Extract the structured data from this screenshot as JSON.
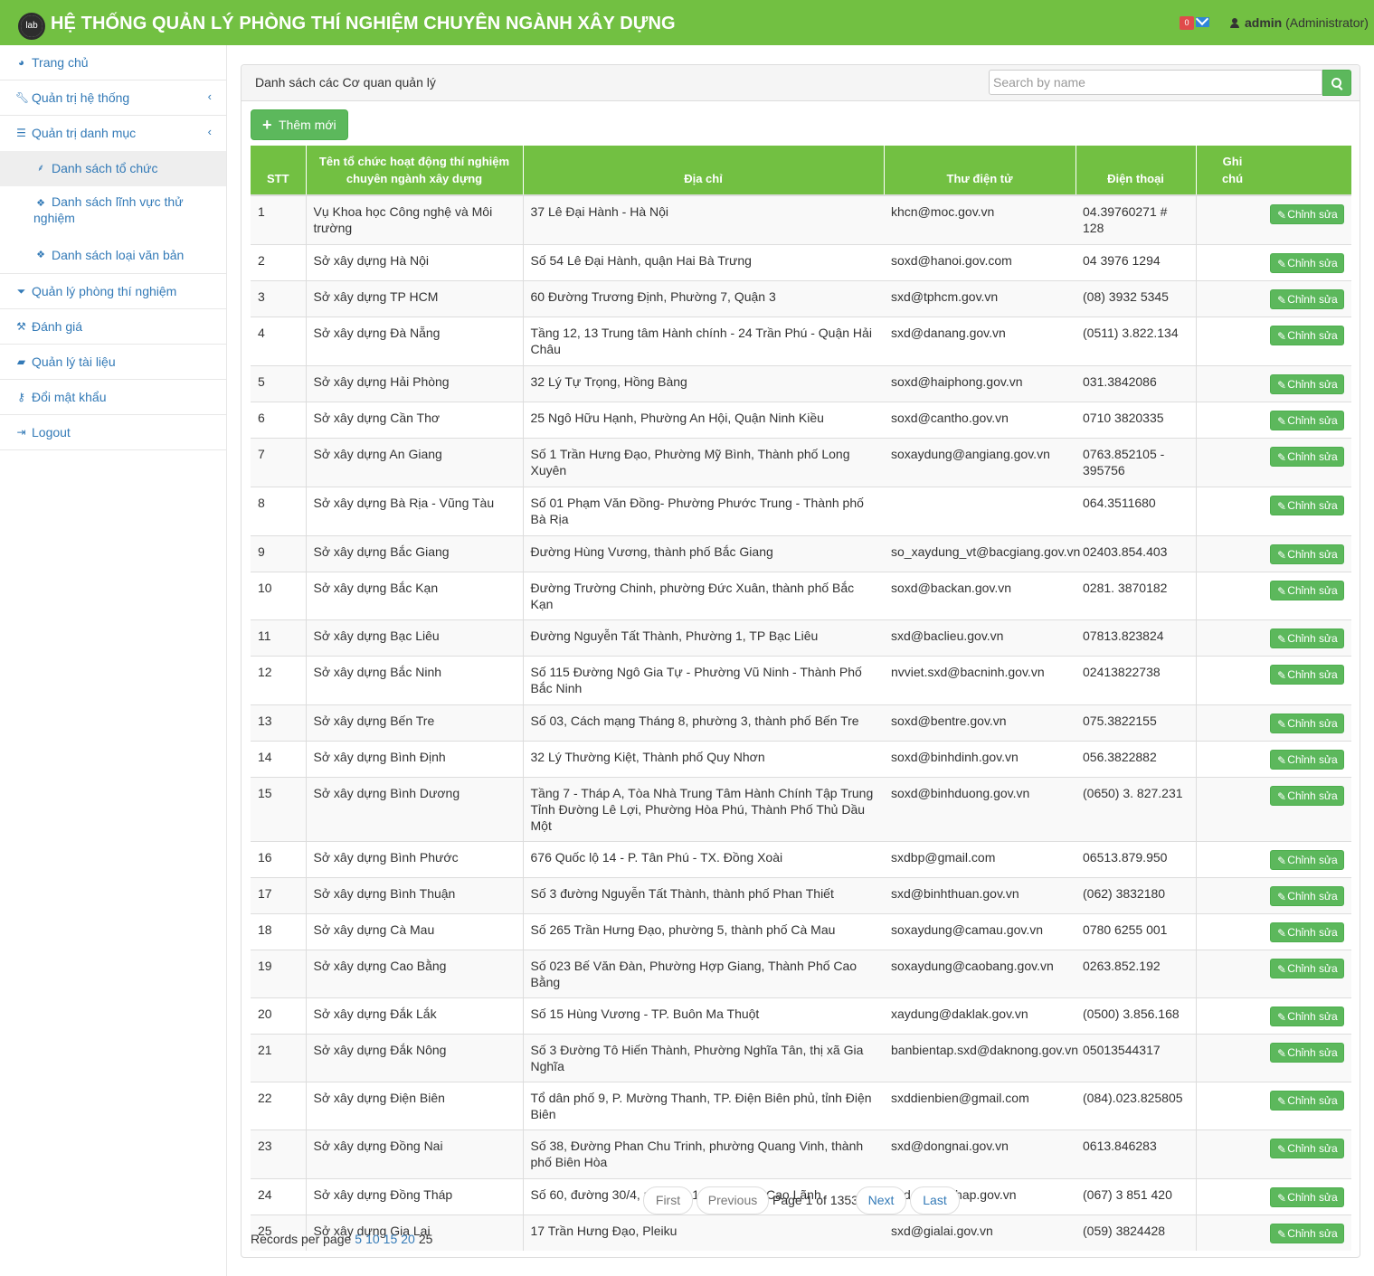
{
  "app": {
    "logo_text": "lab",
    "title": "HỆ THỐNG QUẢN LÝ PHÒNG THÍ NGHIỆM CHUYÊN NGÀNH XÂY DỰNG",
    "notification_count": "0",
    "user_name": "admin",
    "user_role": "(Administrator)"
  },
  "sidebar": {
    "items": [
      {
        "label": "Trang chủ",
        "icon": "dashboard-icon"
      },
      {
        "label": "Quản trị hệ thống",
        "icon": "wrench-icon"
      },
      {
        "label": "Quản trị danh mục",
        "icon": "list-icon"
      },
      {
        "label": "Danh sách tổ chức",
        "icon": "sitemap-icon"
      },
      {
        "label": "Danh sách lĩnh vực thử nghiệm",
        "icon": "cubes-icon"
      },
      {
        "label": "Danh sách loại văn bản",
        "icon": "cubes-icon"
      },
      {
        "label": "Quản lý phòng thí nghiệm",
        "icon": "filter-icon"
      },
      {
        "label": "Đánh giá",
        "icon": "gavel-icon"
      },
      {
        "label": "Quản lý tài liệu",
        "icon": "folder-icon"
      },
      {
        "label": "Đổi mật khẩu",
        "icon": "key-icon"
      },
      {
        "label": "Logout",
        "icon": "sign-out-icon"
      }
    ]
  },
  "panel": {
    "title": "Danh sách các Cơ quan quản lý",
    "search_placeholder": "Search by name",
    "add_label": "Thêm mới"
  },
  "table": {
    "headers": {
      "stt": "STT",
      "name": "Tên tổ chức hoạt động thí nghiệm chuyên ngành xây dựng",
      "address": "Địa chỉ",
      "email": "Thư điện tử",
      "phone": "Điện thoại",
      "note": "Ghi chú"
    },
    "edit_label": "Chỉnh sửa",
    "rows": [
      {
        "stt": "1",
        "name": "Vụ Khoa học Công nghệ và Môi trường",
        "address": "37 Lê Đại Hành - Hà Nội",
        "email": "khcn@moc.gov.vn",
        "phone": "04.39760271 # 128"
      },
      {
        "stt": "2",
        "name": "Sở xây dựng Hà Nội",
        "address": "Số 54 Lê Đại Hành, quận Hai Bà Trưng",
        "email": "soxd@hanoi.gov.com",
        "phone": "04 3976 1294"
      },
      {
        "stt": "3",
        "name": "Sở xây dựng TP HCM",
        "address": "60 Đường Trương Định, Phường 7, Quận 3",
        "email": "sxd@tphcm.gov.vn",
        "phone": "(08) 3932 5345"
      },
      {
        "stt": "4",
        "name": "Sở xây dựng Đà Nẵng",
        "address": "Tầng 12, 13 Trung tâm Hành chính - 24 Trần Phú - Quận Hải Châu",
        "email": "sxd@danang.gov.vn",
        "phone": "(0511) 3.822.134"
      },
      {
        "stt": "5",
        "name": "Sở xây dựng Hải Phòng",
        "address": "32 Lý Tự Trọng, Hồng Bàng",
        "email": "soxd@haiphong.gov.vn",
        "phone": "031.3842086"
      },
      {
        "stt": "6",
        "name": "Sở xây dựng Cần Thơ",
        "address": "25 Ngô Hữu Hạnh, Phường An Hội, Quận Ninh Kiều",
        "email": "soxd@cantho.gov.vn",
        "phone": "0710 3820335"
      },
      {
        "stt": "7",
        "name": "Sở xây dựng An Giang",
        "address": "Số 1 Trần Hưng Đạo, Phường Mỹ Bình, Thành phố Long Xuyên",
        "email": "soxaydung@angiang.gov.vn",
        "phone": "0763.852105 - 395756"
      },
      {
        "stt": "8",
        "name": "Sở xây dựng Bà Rịa - Vũng Tàu",
        "address": "Số 01 Phạm Văn Đồng- Phường Phước Trung - Thành phố Bà Rịa",
        "email": "",
        "phone": "064.3511680"
      },
      {
        "stt": "9",
        "name": "Sở xây dựng Bắc Giang",
        "address": "Đường Hùng Vương, thành phố Bắc Giang",
        "email": "so_xaydung_vt@bacgiang.gov.vn",
        "phone": "02403.854.403"
      },
      {
        "stt": "10",
        "name": "Sở xây dựng Bắc Kạn",
        "address": "Đường Trường Chinh, phường Đức Xuân, thành phố Bắc Kạn",
        "email": "soxd@backan.gov.vn",
        "phone": "0281. 3870182"
      },
      {
        "stt": "11",
        "name": "Sở xây dựng Bạc Liêu",
        "address": "Đường Nguyễn Tất Thành, Phường 1, TP Bạc Liêu",
        "email": "sxd@baclieu.gov.vn",
        "phone": "07813.823824"
      },
      {
        "stt": "12",
        "name": "Sở xây dựng Bắc Ninh",
        "address": "Số 115 Đường Ngô Gia Tự - Phường Vũ Ninh - Thành Phố Bắc Ninh",
        "email": "nvviet.sxd@bacninh.gov.vn",
        "phone": "02413822738"
      },
      {
        "stt": "13",
        "name": "Sở xây dựng Bến Tre",
        "address": "Số 03, Cách mạng Tháng 8, phường 3, thành phố Bến Tre",
        "email": "soxd@bentre.gov.vn",
        "phone": "075.3822155"
      },
      {
        "stt": "14",
        "name": "Sở xây dựng Bình Định",
        "address": "32 Lý Thường Kiệt, Thành phố Quy Nhơn",
        "email": "soxd@binhdinh.gov.vn",
        "phone": "056.3822882"
      },
      {
        "stt": "15",
        "name": "Sở xây dựng Bình Dương",
        "address": "Tầng 7 - Tháp A, Tòa Nhà Trung Tâm Hành Chính Tập Trung Tỉnh Đường Lê Lợi, Phường Hòa Phú, Thành Phố Thủ Dầu Một",
        "email": "soxd@binhduong.gov.vn",
        "phone": "(0650) 3. 827.231"
      },
      {
        "stt": "16",
        "name": "Sở xây dựng Bình Phước",
        "address": "676 Quốc lộ 14 - P. Tân Phú - TX. Đồng Xoài",
        "email": "sxdbp@gmail.com",
        "phone": "06513.879.950"
      },
      {
        "stt": "17",
        "name": "Sở xây dựng Bình Thuận",
        "address": "Số 3 đường Nguyễn Tất Thành, thành phố Phan Thiết",
        "email": "sxd@binhthuan.gov.vn",
        "phone": "(062) 3832180"
      },
      {
        "stt": "18",
        "name": "Sở xây dựng Cà Mau",
        "address": "Số 265 Trần Hưng Đạo, phường 5, thành phố Cà Mau",
        "email": "soxaydung@camau.gov.vn",
        "phone": "0780 6255 001"
      },
      {
        "stt": "19",
        "name": "Sở xây dựng Cao Bằng",
        "address": "Số 023 Bế Văn Đàn, Phường Hợp Giang, Thành Phố Cao Bằng",
        "email": "soxaydung@caobang.gov.vn",
        "phone": "0263.852.192"
      },
      {
        "stt": "20",
        "name": "Sở xây dựng Đắk Lắk",
        "address": "Số 15 Hùng Vương - TP. Buôn Ma Thuột",
        "email": "xaydung@daklak.gov.vn",
        "phone": "(0500) 3.856.168"
      },
      {
        "stt": "21",
        "name": "Sở xây dựng Đắk Nông",
        "address": "Số 3 Đường Tô Hiến Thành, Phường Nghĩa Tân, thị xã Gia Nghĩa",
        "email": "banbientap.sxd@daknong.gov.vn",
        "phone": "05013544317"
      },
      {
        "stt": "22",
        "name": "Sở xây dựng Điện Biên",
        "address": "Tổ dân phố 9, P. Mường Thanh, TP. Điện Biên phủ, tỉnh Điện Biên",
        "email": "sxddienbien@gmail.com",
        "phone": "(084).023.825805"
      },
      {
        "stt": "23",
        "name": "Sở xây dựng Đồng Nai",
        "address": "Số 38, Đường Phan Chu Trinh, phường Quang Vinh, thành phố Biên Hòa",
        "email": "sxd@dongnai.gov.vn",
        "phone": "0613.846283"
      },
      {
        "stt": "24",
        "name": "Sở xây dựng Đồng Tháp",
        "address": "Số 60, đường 30/4, phường 1, thành phố Cao Lãnh",
        "email": "sxd@dongthap.gov.vn",
        "phone": "(067) 3 851 420"
      },
      {
        "stt": "25",
        "name": "Sở xây dựng Gia Lai",
        "address": "17 Trần Hưng Đạo, Pleiku",
        "email": "sxd@gialai.gov.vn",
        "phone": "(059) 3824428"
      }
    ]
  },
  "pagination": {
    "first": "First",
    "previous": "Previous",
    "page_info": "Page 1 of 1353",
    "next": "Next",
    "last": "Last",
    "records_label": "Records per page",
    "options": [
      "5",
      "10",
      "15",
      "20"
    ],
    "current": "25"
  },
  "colors": {
    "brand_green": "#72c042",
    "button_green": "#5cb85c",
    "link_blue": "#337ab7",
    "badge_red": "#e04b4b"
  }
}
